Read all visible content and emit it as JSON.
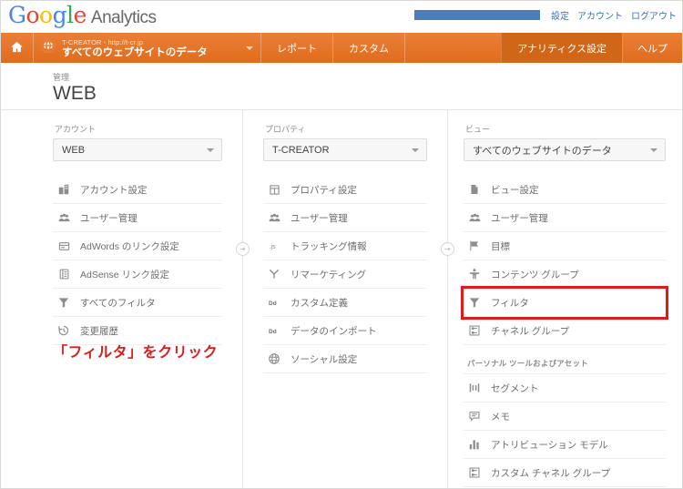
{
  "colors": {
    "nav_orange": "#e8772e",
    "nav_active": "#cf6618",
    "accent_red": "#e01b1b",
    "link_blue": "#3b6fb6",
    "text_gray": "#6d6d6d"
  },
  "topbar": {
    "logo_google": "Google",
    "logo_product": "Analytics",
    "links": [
      {
        "label": "設定",
        "name": "settings-link"
      },
      {
        "label": "アカウント",
        "name": "account-link"
      },
      {
        "label": "ログアウト",
        "name": "logout-link"
      }
    ]
  },
  "navbar": {
    "home_icon": "home-icon",
    "property_icon": "globe-icon",
    "property_subtitle": "T-CREATOR - http://t-cr.jp",
    "property_title": "すべてのウェブサイトのデータ",
    "links": [
      {
        "label": "レポート",
        "name": "nav-reports",
        "active": false
      },
      {
        "label": "カスタム",
        "name": "nav-custom",
        "active": false
      }
    ],
    "right_links": [
      {
        "label": "アナリティクス設定",
        "name": "nav-analytics-settings",
        "active": true
      },
      {
        "label": "ヘルプ",
        "name": "nav-help",
        "active": false
      }
    ]
  },
  "page_header": {
    "kicker": "管理",
    "title": "WEB"
  },
  "columns": {
    "account": {
      "label": "アカウント",
      "selected": "WEB",
      "items": [
        {
          "label": "アカウント設定",
          "icon": "building-icon"
        },
        {
          "label": "ユーザー管理",
          "icon": "users-icon"
        },
        {
          "label": "AdWords のリンク設定",
          "icon": "adwords-icon"
        },
        {
          "label": "AdSense リンク設定",
          "icon": "adsense-icon"
        },
        {
          "label": "すべてのフィルタ",
          "icon": "filter-icon"
        },
        {
          "label": "変更履歴",
          "icon": "history-icon"
        }
      ]
    },
    "property": {
      "label": "プロパティ",
      "selected": "T-CREATOR",
      "items": [
        {
          "label": "プロパティ設定",
          "icon": "property-icon"
        },
        {
          "label": "ユーザー管理",
          "icon": "users-icon"
        },
        {
          "label": "トラッキング情報",
          "icon": "js-icon"
        },
        {
          "label": "リマーケティング",
          "icon": "remarketing-icon"
        },
        {
          "label": "カスタム定義",
          "icon": "dd-icon"
        },
        {
          "label": "データのインポート",
          "icon": "dd-icon"
        },
        {
          "label": "ソーシャル設定",
          "icon": "social-icon"
        }
      ]
    },
    "view": {
      "label": "ビュー",
      "selected": "すべてのウェブサイトのデータ",
      "items": [
        {
          "label": "ビュー設定",
          "icon": "document-icon",
          "highlight": false
        },
        {
          "label": "ユーザー管理",
          "icon": "users-icon",
          "highlight": false
        },
        {
          "label": "目標",
          "icon": "flag-icon",
          "highlight": false
        },
        {
          "label": "コンテンツ グループ",
          "icon": "content-group-icon",
          "highlight": false
        },
        {
          "label": "フィルタ",
          "icon": "filter-icon",
          "highlight": true
        },
        {
          "label": "チャネル グループ",
          "icon": "channel-group-icon",
          "highlight": false
        }
      ],
      "section_header": "パーソナル ツールおよびアセット",
      "personal_items": [
        {
          "label": "セグメント",
          "icon": "segment-icon"
        },
        {
          "label": "メモ",
          "icon": "note-icon"
        },
        {
          "label": "アトリビューション モデル",
          "icon": "bar-chart-icon"
        },
        {
          "label": "カスタム チャネル グループ",
          "icon": "channel-group-icon"
        }
      ]
    }
  },
  "annotation": {
    "text": "「フィルタ」をクリック"
  }
}
